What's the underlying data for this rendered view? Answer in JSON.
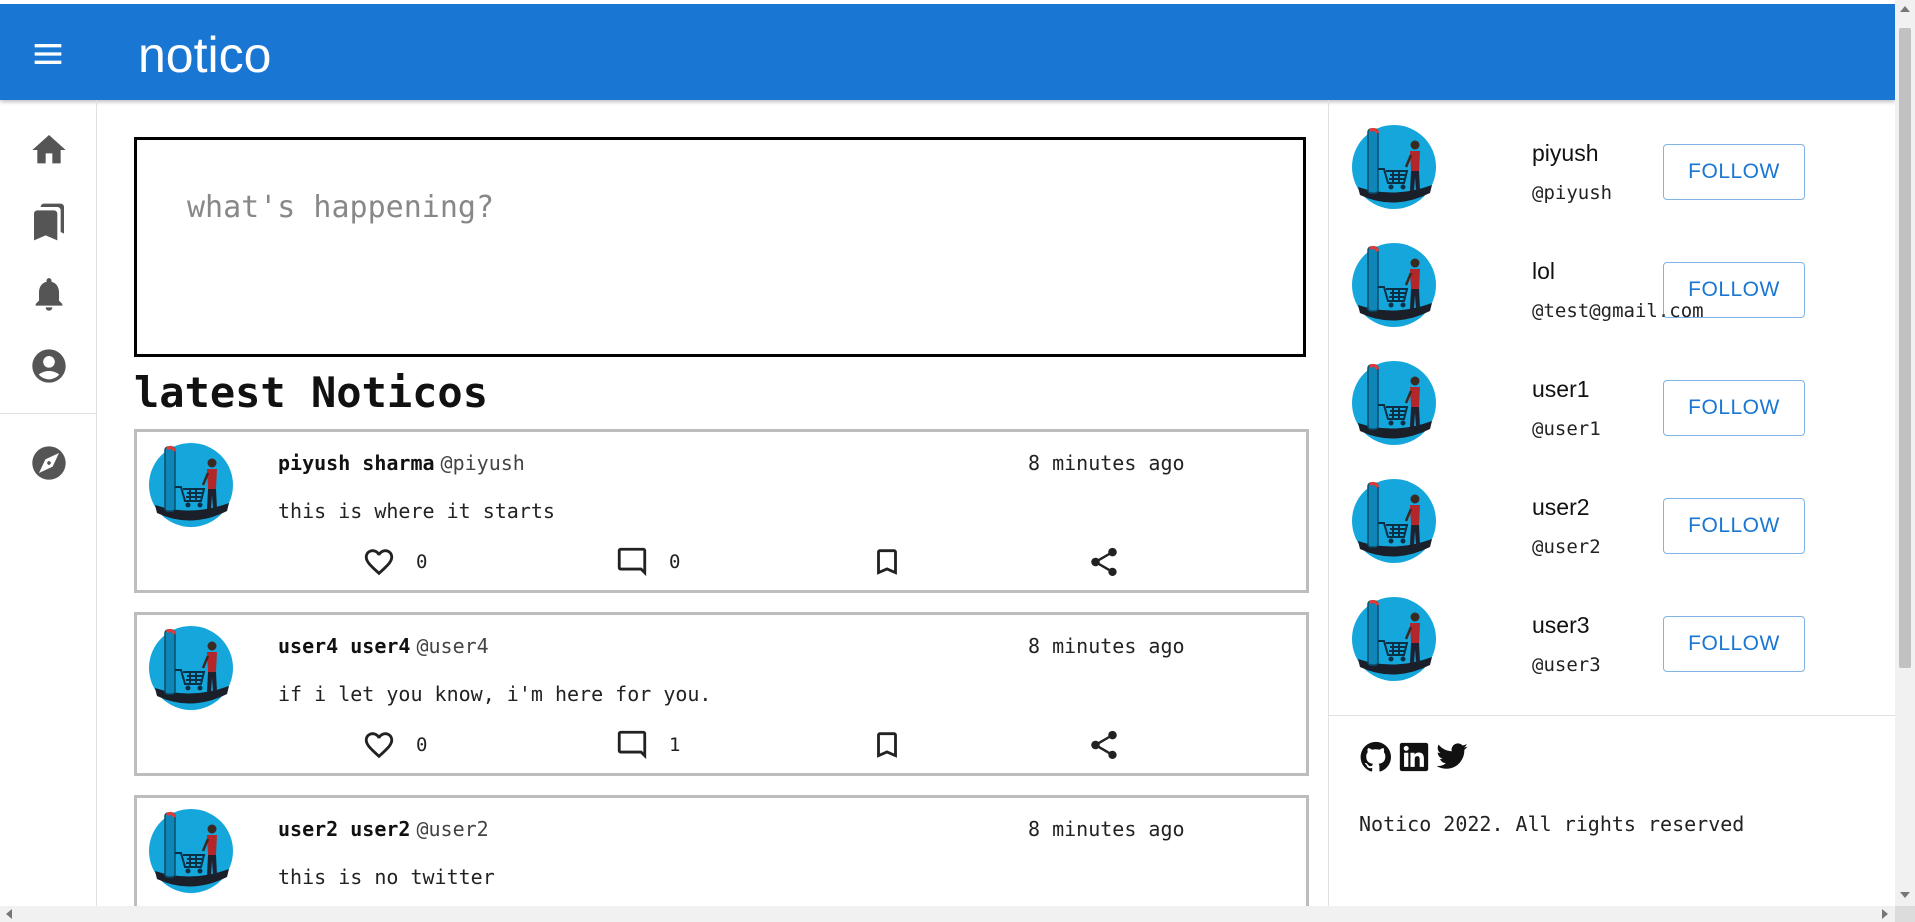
{
  "app": {
    "title": "notico"
  },
  "icons": {
    "menu": "menu-icon",
    "nav": [
      "home-icon",
      "bookmarks-icon",
      "notifications-icon",
      "account-icon",
      "explore-icon"
    ],
    "post_actions": [
      "heart-icon",
      "comment-icon",
      "bookmark-icon",
      "share-icon"
    ],
    "social": [
      "github-icon",
      "linkedin-icon",
      "twitter-icon"
    ]
  },
  "colors": {
    "primary": "#1976d2",
    "appbar_text": "#ffffff",
    "avatar_bg": "#15a6dc"
  },
  "compose": {
    "placeholder": "what's happening?",
    "value": ""
  },
  "feed": {
    "title": "latest Noticos",
    "posts": [
      {
        "name": "piyush sharma",
        "handle": "@piyush",
        "time": "8 minutes ago",
        "text": "this is where it starts",
        "likes": "0",
        "comments": "0"
      },
      {
        "name": "user4 user4",
        "handle": "@user4",
        "time": "8 minutes ago",
        "text": "if i let you know, i'm here for you.",
        "likes": "0",
        "comments": "1"
      },
      {
        "name": "user2 user2",
        "handle": "@user2",
        "time": "8 minutes ago",
        "text": "this is no twitter",
        "likes": "",
        "comments": ""
      }
    ]
  },
  "suggestions": [
    {
      "name": "piyush",
      "handle": "@piyush",
      "button": "FOLLOW"
    },
    {
      "name": "lol",
      "handle": "@test@gmail.com",
      "button": "FOLLOW"
    },
    {
      "name": "user1",
      "handle": "@user1",
      "button": "FOLLOW"
    },
    {
      "name": "user2",
      "handle": "@user2",
      "button": "FOLLOW"
    },
    {
      "name": "user3",
      "handle": "@user3",
      "button": "FOLLOW"
    }
  ],
  "footer": {
    "text": "Notico 2022. All rights reserved"
  }
}
